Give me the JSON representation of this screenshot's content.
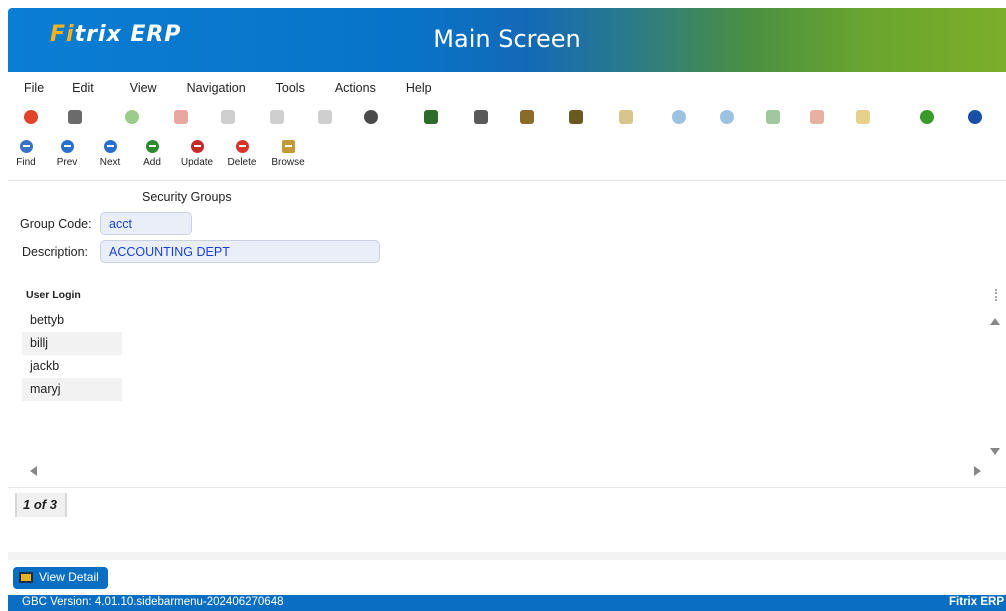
{
  "header": {
    "logo_fi": "Fi",
    "logo_rest": "trix ERP",
    "title": "Main Screen"
  },
  "menu": [
    "File",
    "Edit",
    "View",
    "Navigation",
    "Tools",
    "Actions",
    "Help"
  ],
  "toolbar_icons": [
    {
      "name": "power-icon",
      "color": "#e0442a",
      "shape": "circle"
    },
    {
      "name": "copy-icon",
      "color": "#6b6b6b",
      "shape": "square"
    },
    {
      "name": "check-icon",
      "color": "#9ccc8c",
      "shape": "circle"
    },
    {
      "name": "cancel-icon",
      "color": "#e9a7a0",
      "shape": "square"
    },
    {
      "name": "paste-icon",
      "color": "#cfcfcf",
      "shape": "square"
    },
    {
      "name": "clipboard-icon",
      "color": "#cfcfcf",
      "shape": "square"
    },
    {
      "name": "document-icon",
      "color": "#cfcfcf",
      "shape": "square"
    },
    {
      "name": "zoom-icon",
      "color": "#4a4a4a",
      "shape": "circle"
    },
    {
      "name": "calendar-icon",
      "color": "#2e6b2b",
      "shape": "square"
    },
    {
      "name": "attach-icon",
      "color": "#5a5a5a",
      "shape": "square"
    },
    {
      "name": "edit-document-icon",
      "color": "#8a6b2a",
      "shape": "square"
    },
    {
      "name": "checklist-icon",
      "color": "#6b5a1f",
      "shape": "square"
    },
    {
      "name": "image-icon",
      "color": "#d7c58c",
      "shape": "square"
    },
    {
      "name": "down-circle-icon",
      "color": "#9cc3e3",
      "shape": "circle"
    },
    {
      "name": "up-circle-icon",
      "color": "#9cc3e3",
      "shape": "circle"
    },
    {
      "name": "settings-add-icon",
      "color": "#9fc7a0",
      "shape": "square"
    },
    {
      "name": "chart-icon",
      "color": "#e8b0a0",
      "shape": "square"
    },
    {
      "name": "flask-icon",
      "color": "#e6d08a",
      "shape": "square"
    },
    {
      "name": "globe-icon",
      "color": "#3a9a2a",
      "shape": "circle"
    },
    {
      "name": "help-icon",
      "color": "#1a4fa8",
      "shape": "circle"
    }
  ],
  "actions": [
    {
      "label": "Find",
      "name": "find",
      "color": "#3a72c8"
    },
    {
      "label": "Prev",
      "name": "prev",
      "color": "#2a6fd0"
    },
    {
      "label": "Next",
      "name": "next",
      "color": "#2a6fd0"
    },
    {
      "label": "Add",
      "name": "add",
      "color": "#2f8a2f"
    },
    {
      "label": "Update",
      "name": "update",
      "color": "#c62828"
    },
    {
      "label": "Delete",
      "name": "delete",
      "color": "#d8362b"
    },
    {
      "label": "Browse",
      "name": "browse",
      "color": "#c29a3a"
    }
  ],
  "form": {
    "section_title": "Security Groups",
    "group_code_label": "Group Code:",
    "group_code_value": "acct",
    "description_label": "Description:",
    "description_value": "ACCOUNTING DEPT"
  },
  "table": {
    "column_header": "User Login",
    "rows": [
      "bettyb",
      "billj",
      "jackb",
      "maryj"
    ]
  },
  "pager": "1 of 3",
  "view_detail": "View Detail",
  "status": {
    "version": "GBC Version: 4.01.10.sidebarmenu-202406270648",
    "app": "Fitrix ERP"
  }
}
